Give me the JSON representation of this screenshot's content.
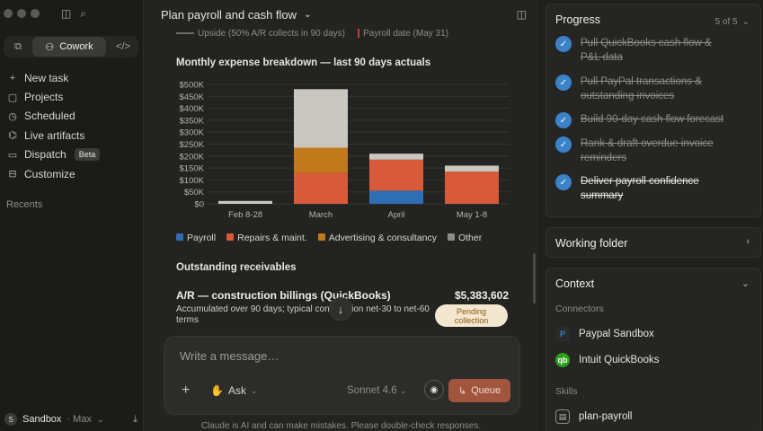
{
  "sidebar": {
    "modes": {
      "chat_icon": "chat-bubbles-icon",
      "cowork": "Cowork",
      "code_icon": "code-icon"
    },
    "items": [
      {
        "icon": "+",
        "label": "New task"
      },
      {
        "icon": "▢",
        "label": "Projects"
      },
      {
        "icon": "◷",
        "label": "Scheduled"
      },
      {
        "icon": "⌬",
        "label": "Live artifacts"
      },
      {
        "icon": "▭",
        "label": "Dispatch",
        "badge": "Beta"
      },
      {
        "icon": "⊟",
        "label": "Customize"
      }
    ],
    "recents_label": "Recents",
    "account": {
      "initial": "S",
      "name": "Sandbox",
      "plan": "· Max"
    }
  },
  "main": {
    "title": "Plan payroll and cash flow",
    "legend_top": {
      "upside": "Upside (50% A/R collects in 90 days)",
      "payroll_date": "Payroll date (May 31)"
    },
    "chart_title": "Monthly expense breakdown — last 90 days actuals",
    "receivables_title": "Outstanding receivables",
    "receivable": {
      "title": "A/R — construction billings (QuickBooks)",
      "amount": "$5,383,602",
      "desc": "Accumulated over 90 days; typical construction net-30 to net-60 terms",
      "badge_line1": "Pending",
      "badge_line2": "collection"
    },
    "composer": {
      "placeholder": "Write a message…",
      "ask": "Ask",
      "model": "Sonnet 4.6",
      "queue": "Queue"
    },
    "disclaimer": "Claude is AI and can make mistakes. Please double-check responses."
  },
  "progress": {
    "title": "Progress",
    "count": "5 of 5",
    "steps": [
      {
        "line1": "Pull QuickBooks cash flow &",
        "line2": "P&L data"
      },
      {
        "line1": "Pull PayPal transactions &",
        "line2": "outstanding invoices"
      },
      {
        "line1": "Build 90-day cash flow forecast",
        "line2": ""
      },
      {
        "line1": "Rank & draft overdue invoice",
        "line2": "reminders"
      },
      {
        "line1": "Deliver payroll confidence",
        "line2": "summary"
      }
    ]
  },
  "working_folder": {
    "title": "Working folder"
  },
  "context": {
    "title": "Context",
    "connectors_label": "Connectors",
    "connectors": [
      {
        "name": "Paypal Sandbox",
        "icon": "P"
      },
      {
        "name": "Intuit QuickBooks",
        "icon": "qb"
      }
    ],
    "skills_label": "Skills",
    "skills": [
      {
        "name": "plan-payroll"
      }
    ]
  },
  "colors": {
    "payroll": "#2f6db5",
    "repairs": "#d85a3a",
    "advertising": "#c07a1c",
    "other": "#c9c7c0",
    "accent_blue": "#3b82c8",
    "queue": "#a2553d"
  },
  "chart_data": {
    "type": "bar",
    "stacked": true,
    "title": "Monthly expense breakdown — last 90 days actuals",
    "categories": [
      "Feb 8-28",
      "March",
      "April",
      "May 1-8"
    ],
    "yticks": [
      "$0",
      "$50K",
      "$100K",
      "$150K",
      "$200K",
      "$250K",
      "$300K",
      "$350K",
      "$400K",
      "$450K",
      "$500K"
    ],
    "ylim": [
      0,
      500000
    ],
    "series": [
      {
        "name": "Payroll",
        "color": "#2f6db5",
        "values": [
          0,
          0,
          55000,
          0
        ]
      },
      {
        "name": "Repairs & maint.",
        "color": "#d85a3a",
        "values": [
          0,
          130000,
          130000,
          135000
        ]
      },
      {
        "name": "Advertising & consultancy",
        "color": "#c07a1c",
        "values": [
          0,
          105000,
          0,
          0
        ]
      },
      {
        "name": "Other",
        "color": "#c9c7c0",
        "values": [
          12000,
          245000,
          25000,
          25000
        ]
      }
    ],
    "legend_position": "bottom",
    "grid": true
  }
}
